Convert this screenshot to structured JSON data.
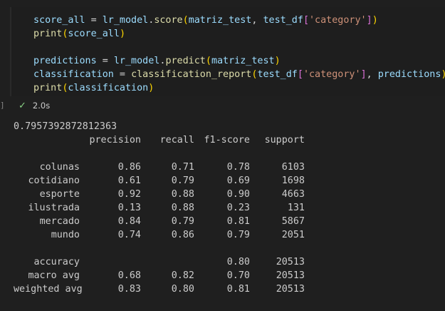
{
  "cell": {
    "gutter_mark": "]",
    "code_lines": [
      [
        [
          "score_all",
          "var"
        ],
        [
          " = ",
          "op"
        ],
        [
          "lr_model",
          "var"
        ],
        [
          ".",
          "op"
        ],
        [
          "score",
          "fn"
        ],
        [
          "(",
          "paren1"
        ],
        [
          "matriz_test",
          "var"
        ],
        [
          ", ",
          "op"
        ],
        [
          "test_df",
          "var"
        ],
        [
          "[",
          "paren2"
        ],
        [
          "'category'",
          "str"
        ],
        [
          "]",
          "paren2"
        ],
        [
          ")",
          "paren1"
        ]
      ],
      [
        [
          "print",
          "fn"
        ],
        [
          "(",
          "paren1"
        ],
        [
          "score_all",
          "var"
        ],
        [
          ")",
          "paren1"
        ]
      ],
      [],
      [
        [
          "predictions",
          "var"
        ],
        [
          " = ",
          "op"
        ],
        [
          "lr_model",
          "var"
        ],
        [
          ".",
          "op"
        ],
        [
          "predict",
          "fn"
        ],
        [
          "(",
          "paren1"
        ],
        [
          "matriz_test",
          "var"
        ],
        [
          ")",
          "paren1"
        ]
      ],
      [
        [
          "classification",
          "var"
        ],
        [
          " = ",
          "op"
        ],
        [
          "classification_report",
          "fn"
        ],
        [
          "(",
          "paren1"
        ],
        [
          "test_df",
          "var"
        ],
        [
          "[",
          "paren2"
        ],
        [
          "'category'",
          "str"
        ],
        [
          "]",
          "paren2"
        ],
        [
          ", ",
          "op"
        ],
        [
          "predictions",
          "var"
        ],
        [
          ")",
          "paren1"
        ]
      ],
      [
        [
          "print",
          "fn"
        ],
        [
          "(",
          "paren1"
        ],
        [
          "classification",
          "var"
        ],
        [
          ")",
          "paren1"
        ]
      ]
    ],
    "status_icon": "check-icon",
    "exec_time": "2.0s"
  },
  "output": {
    "score": "0.7957392872812363",
    "headers": [
      "precision",
      "recall",
      "f1-score",
      "support"
    ],
    "rows": [
      {
        "label": "colunas",
        "precision": "0.86",
        "recall": "0.71",
        "f1": "0.78",
        "support": "6103"
      },
      {
        "label": "cotidiano",
        "precision": "0.61",
        "recall": "0.79",
        "f1": "0.69",
        "support": "1698"
      },
      {
        "label": "esporte",
        "precision": "0.92",
        "recall": "0.88",
        "f1": "0.90",
        "support": "4663"
      },
      {
        "label": "ilustrada",
        "precision": "0.13",
        "recall": "0.88",
        "f1": "0.23",
        "support": "131"
      },
      {
        "label": "mercado",
        "precision": "0.84",
        "recall": "0.79",
        "f1": "0.81",
        "support": "5867"
      },
      {
        "label": "mundo",
        "precision": "0.74",
        "recall": "0.86",
        "f1": "0.79",
        "support": "2051"
      },
      null,
      {
        "label": "accuracy",
        "precision": "",
        "recall": "",
        "f1": "0.80",
        "support": "20513"
      },
      {
        "label": "macro avg",
        "precision": "0.68",
        "recall": "0.82",
        "f1": "0.70",
        "support": "20513"
      },
      {
        "label": "weighted avg",
        "precision": "0.83",
        "recall": "0.80",
        "f1": "0.81",
        "support": "20513"
      }
    ]
  },
  "colors": {
    "background": "#1f1f1f",
    "variable": "#9cdcfe",
    "function": "#dcdcaa",
    "string": "#ce9178",
    "bracket_outer": "#ffd700",
    "bracket_inner": "#da70d6",
    "success": "#89d185"
  }
}
